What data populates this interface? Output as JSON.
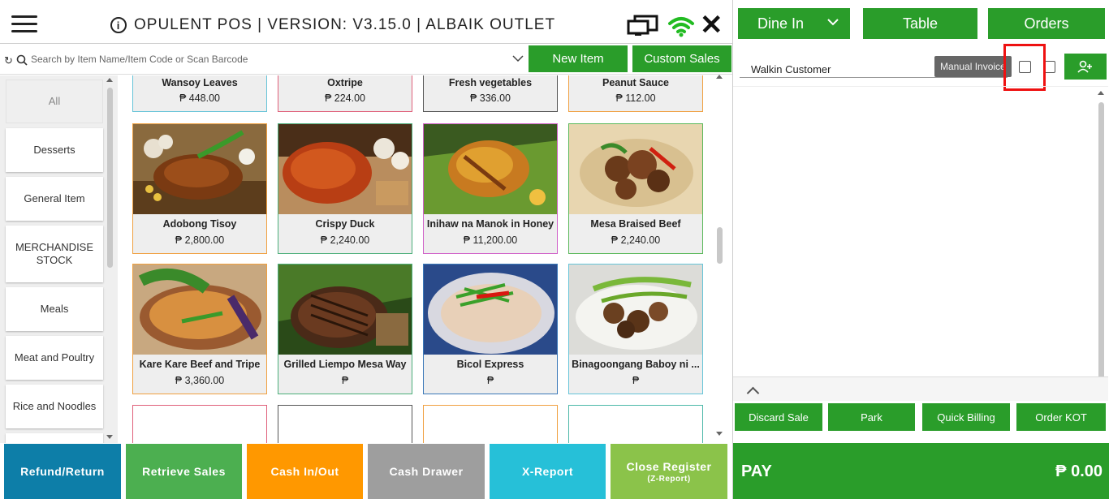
{
  "header": {
    "title": "OPULENT POS | VERSION: V3.15.0 | ALBAIK OUTLET"
  },
  "search": {
    "placeholder": "Search by Item Name/Item Code or Scan Barcode"
  },
  "actions": {
    "new_item": "New Item",
    "custom_sales": "Custom Sales"
  },
  "categories": [
    {
      "label": "All",
      "active": true
    },
    {
      "label": "Desserts"
    },
    {
      "label": "General Item"
    },
    {
      "label": "MERCHANDISE STOCK"
    },
    {
      "label": "Meals"
    },
    {
      "label": "Meat and Poultry"
    },
    {
      "label": "Rice and Noodles"
    }
  ],
  "products_top": [
    {
      "name": "Wansoy Leaves",
      "price": "₱ 448.00",
      "border": "#66c4d8"
    },
    {
      "name": "Oxtripe",
      "price": "₱ 224.00",
      "border": "#e0607a"
    },
    {
      "name": "Fresh vegetables",
      "price": "₱ 336.00",
      "border": "#555555"
    },
    {
      "name": "Peanut Sauce",
      "price": "₱ 112.00",
      "border": "#f0a040"
    }
  ],
  "products_row1": [
    {
      "name": "Adobong Tisoy",
      "price": "₱ 2,800.00",
      "border": "#f0a040",
      "icon": "dish-image"
    },
    {
      "name": "Crispy Duck",
      "price": "₱ 2,240.00",
      "border": "#4caf7a",
      "icon": "dish-image"
    },
    {
      "name": "Inihaw na Manok in Honey",
      "price": "₱ 11,200.00",
      "border": "#d060c8",
      "icon": "dish-image"
    },
    {
      "name": "Mesa Braised Beef",
      "price": "₱ 2,240.00",
      "border": "#5ab85a",
      "icon": "dish-image"
    }
  ],
  "products_row2": [
    {
      "name": "Kare Kare Beef and Tripe",
      "price": "₱ 3,360.00",
      "border": "#f0a040",
      "icon": "dish-image"
    },
    {
      "name": "Grilled Liempo Mesa Way",
      "price": "₱",
      "border": "#4caf7a",
      "icon": "dish-image"
    },
    {
      "name": "Bicol Express",
      "price": "₱",
      "border": "#3a78b8",
      "icon": "dish-image"
    },
    {
      "name": "Binagoongang Baboy ni ...",
      "price": "₱",
      "border": "#66c4d8",
      "icon": "dish-image"
    }
  ],
  "products_bottom_borders": [
    "#e0607a",
    "#555555",
    "#f0a040",
    "#4cb8a8"
  ],
  "right_panel": {
    "order_type": "Dine In",
    "table": "Table",
    "orders": "Orders",
    "customer": "Walkin Customer",
    "manual_invoice_tooltip": "Manual Invoice",
    "buttons": [
      "Discard Sale",
      "Park",
      "Quick Billing",
      "Order KOT"
    ],
    "pay_label": "PAY",
    "pay_amount": "₱ 0.00"
  },
  "bottom_bar": [
    {
      "label": "Refund/Return",
      "color": "#0d7ea8"
    },
    {
      "label": "Retrieve Sales",
      "color": "#4caf50"
    },
    {
      "label": "Cash In/Out",
      "color": "#ff9800"
    },
    {
      "label": "Cash Drawer",
      "color": "#9e9e9e"
    },
    {
      "label": "X-Report",
      "color": "#26c0d8"
    },
    {
      "label": "Close Register",
      "sub": "(Z-Report)",
      "color": "#8bc34a"
    }
  ]
}
